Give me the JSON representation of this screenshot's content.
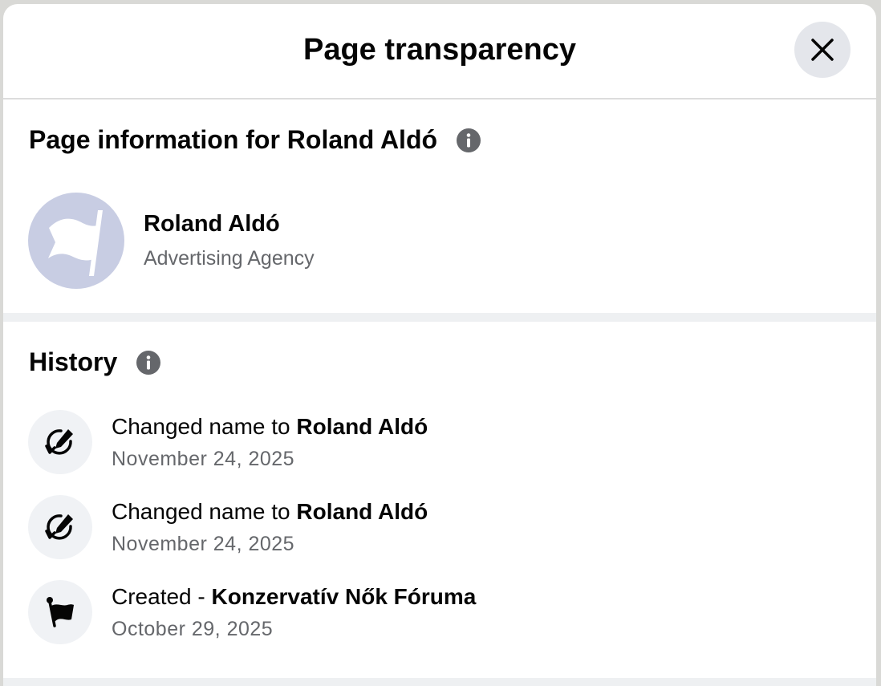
{
  "dialog": {
    "title": "Page transparency"
  },
  "page_info": {
    "heading": "Page information for Roland Aldó",
    "name": "Roland Aldó",
    "category": "Advertising Agency"
  },
  "history": {
    "heading": "History",
    "items": [
      {
        "prefix": "Changed name to ",
        "value": "Roland Aldó",
        "date": "November 24, 2025",
        "icon": "edit-rotate-icon"
      },
      {
        "prefix": "Changed name to ",
        "value": "Roland Aldó",
        "date": "November 24, 2025",
        "icon": "edit-rotate-icon"
      },
      {
        "prefix": "Created - ",
        "value": "Konzervatív Nők Fóruma",
        "date": "October 29, 2025",
        "icon": "flag-icon"
      }
    ]
  },
  "colors": {
    "avatar_bg": "#c8cde3",
    "icon_bg": "#f0f2f5",
    "secondary_text": "#65676b",
    "close_bg": "#e4e6eb"
  }
}
